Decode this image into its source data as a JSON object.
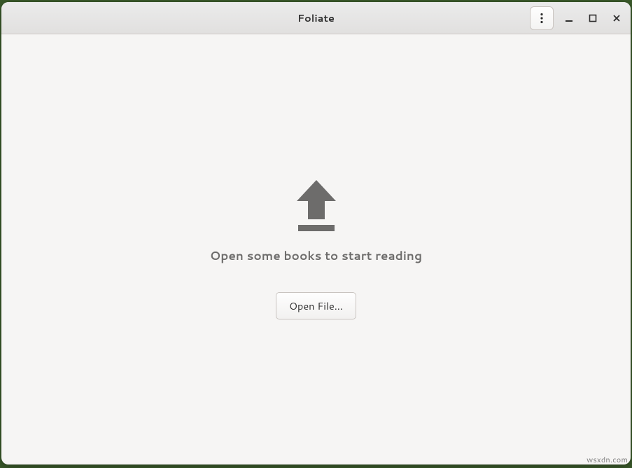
{
  "window": {
    "title": "Foliate"
  },
  "content": {
    "empty_message": "Open some books to start reading",
    "open_button_label": "Open File…"
  },
  "watermark": "wsxdn.com"
}
